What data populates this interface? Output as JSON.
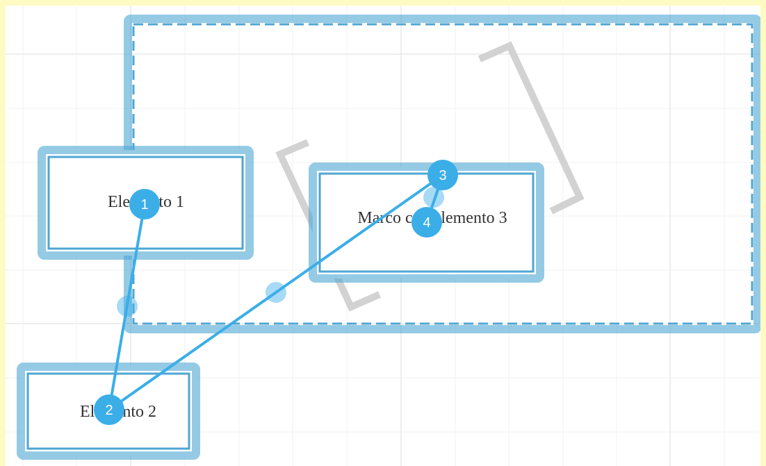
{
  "colors": {
    "background_border": "#fdfbc2",
    "selection": "#4ea6d3",
    "connector": "#3baee8",
    "grid": "#d9d9d9",
    "bracket": "#d0d0d0"
  },
  "elements": [
    {
      "label": "Elemento 1"
    },
    {
      "label": "Elemento 2"
    },
    {
      "label": "Marco con elemento 3"
    }
  ],
  "markers": [
    "1",
    "2",
    "3",
    "4"
  ]
}
